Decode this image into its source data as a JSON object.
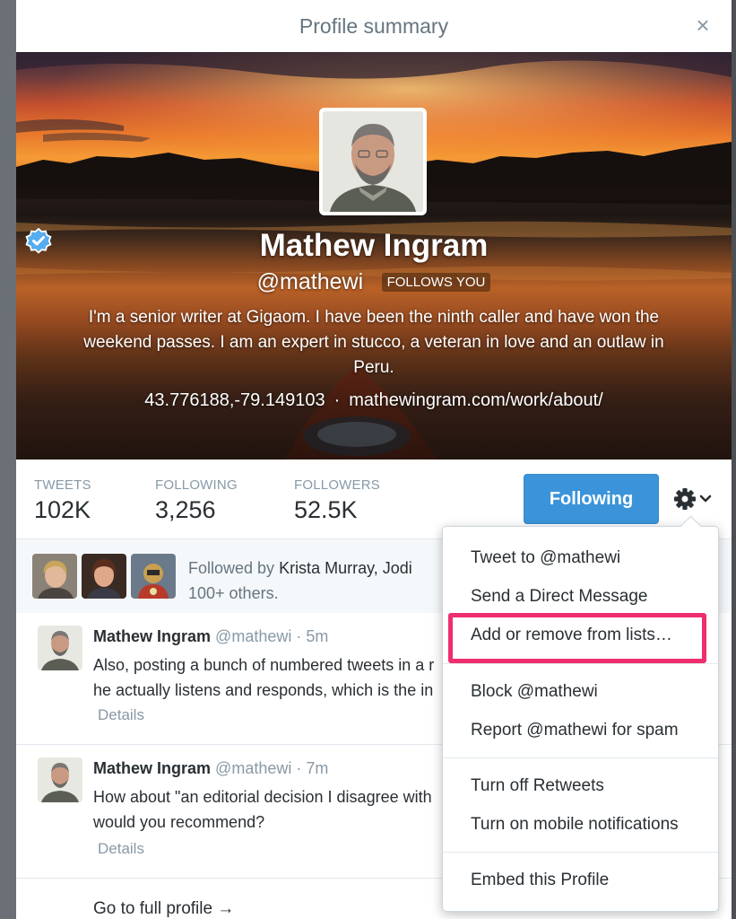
{
  "modal": {
    "title": "Profile summary",
    "close_glyph": "×"
  },
  "profile": {
    "name": "Mathew Ingram",
    "handle": "@mathewi",
    "follows_you": "FOLLOWS YOU",
    "bio": "I'm a senior writer at Gigaom. I have been the ninth caller and have won the weekend passes. I am an expert in stucco, a veteran in love and an outlaw in Peru.",
    "location": "43.776188,-79.149103",
    "separator": "·",
    "website": "mathewingram.com/work/about/"
  },
  "stats": {
    "tweets_label": "TWEETS",
    "tweets_value": "102K",
    "following_label": "FOLLOWING",
    "following_value": "3,256",
    "followers_label": "FOLLOWERS",
    "followers_value": "52.5K"
  },
  "actions": {
    "following_button": "Following",
    "gear_caret": "⌄"
  },
  "followed_by": {
    "prefix": "Followed by ",
    "names": "Krista Murray, Jodi",
    "suffix": "100+ others."
  },
  "tweets": [
    {
      "name": "Mathew Ingram",
      "handle": "@mathewi",
      "time": "· 5m",
      "line1": "Also, posting a bunch of numbered tweets in a r",
      "line2": "he actually listens and responds, which is the in",
      "details": "Details"
    },
    {
      "name": "Mathew Ingram",
      "handle": "@mathewi",
      "time": "· 7m",
      "line1": "How about \"an editorial decision I disagree with",
      "line2": "would you recommend?",
      "details": "Details"
    }
  ],
  "full_profile_link": "Go to full profile →",
  "menu": {
    "tweet_to": "Tweet to @mathewi",
    "send_dm": "Send a Direct Message",
    "add_remove_lists": "Add or remove from lists…",
    "block": "Block @mathewi",
    "report_spam": "Report @mathewi for spam",
    "turn_off_retweets": "Turn off Retweets",
    "mobile_notifications": "Turn on mobile notifications",
    "embed_profile": "Embed this Profile"
  },
  "colors": {
    "accent_blue": "#3b94d9",
    "highlight_pink": "#ee2e6e",
    "verified_blue": "#55acee"
  }
}
